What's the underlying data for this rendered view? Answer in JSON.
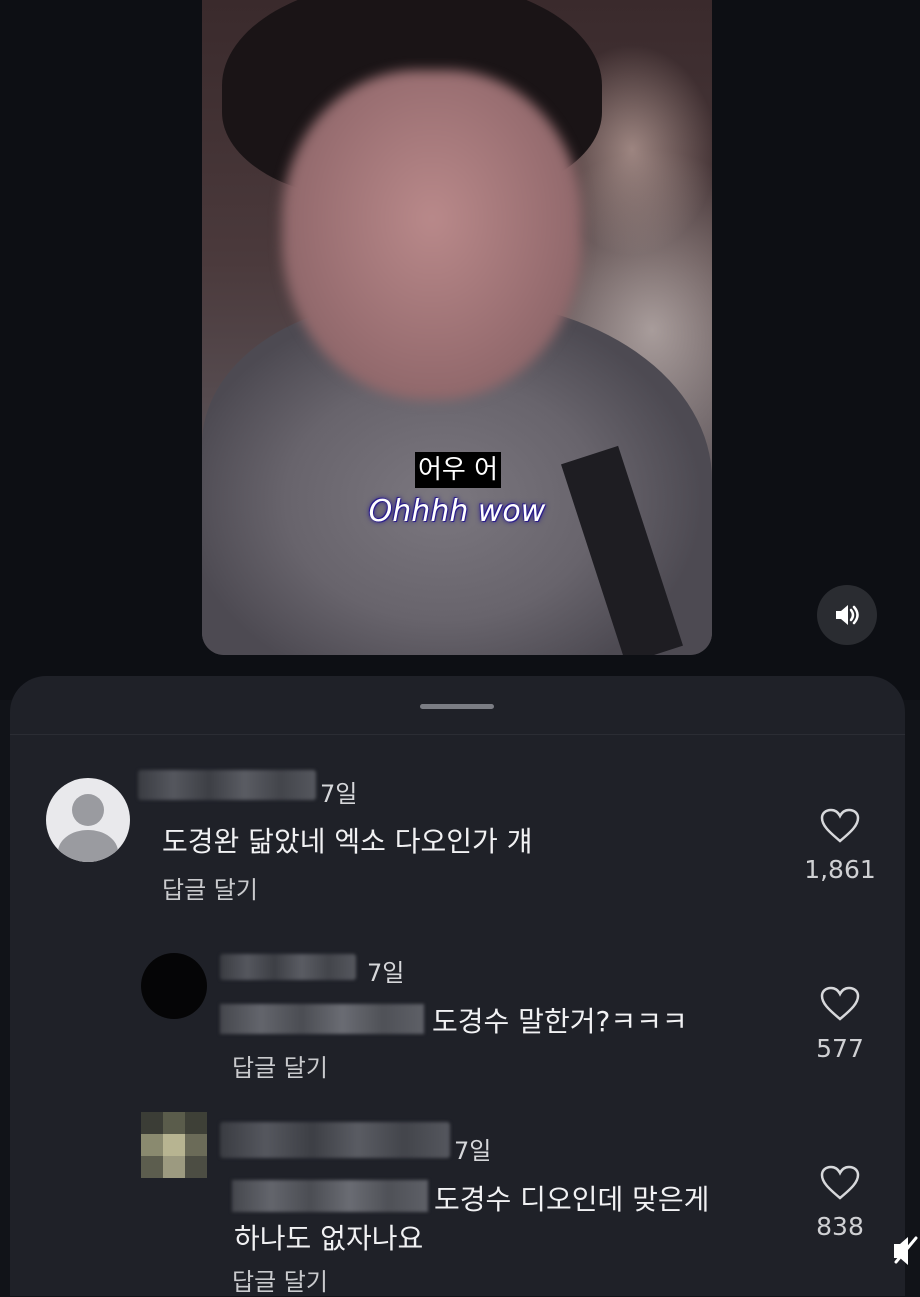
{
  "video": {
    "caption_korean": "어우 어",
    "caption_english": "Ohhhh wow"
  },
  "comments": [
    {
      "time": "7일",
      "text": "도경완 닮았네 엑소 다오인가 걔",
      "reply_label": "답글 달기",
      "likes": "1,861"
    },
    {
      "time": "7일",
      "text": "도경수 말한거?ㅋㅋㅋ",
      "reply_label": "답글 달기",
      "likes": "577"
    },
    {
      "time": "7일",
      "text_line1": "도경수 디오인데 맞은게",
      "text_line2": "하나도 없자나요",
      "reply_label": "답글 달기",
      "likes": "838"
    }
  ]
}
